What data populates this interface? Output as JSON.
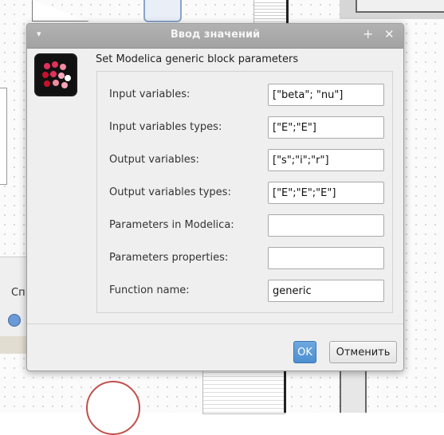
{
  "dialog": {
    "title": "Ввод значений",
    "menu_icon": "▾",
    "maximize_icon": "+",
    "close_icon": "✕",
    "heading": "Set Modelica generic block parameters",
    "app_icon": "modelica-block-icon"
  },
  "params": [
    {
      "label": "Input variables:",
      "value": "[\"beta\"; \"nu\"]"
    },
    {
      "label": "Input variables types:",
      "value": "[\"E\";\"E\"]"
    },
    {
      "label": "Output variables:",
      "value": "[\"s\";\"i\";\"r\"]"
    },
    {
      "label": "Output variables types:",
      "value": "[\"E\";\"E\";\"E\"]"
    },
    {
      "label": "Parameters in Modelica:",
      "value": ""
    },
    {
      "label": "Parameters properties:",
      "value": ""
    },
    {
      "label": "Function name:",
      "value": "generic"
    }
  ],
  "buttons": {
    "ok": "OK",
    "cancel": "Отменить"
  },
  "background": {
    "left_panel_text": "Сп"
  },
  "colors": {
    "ok_button": "#4d8fd0",
    "titlebar": "#a8a8a8",
    "dialog_bg": "#efefef"
  }
}
